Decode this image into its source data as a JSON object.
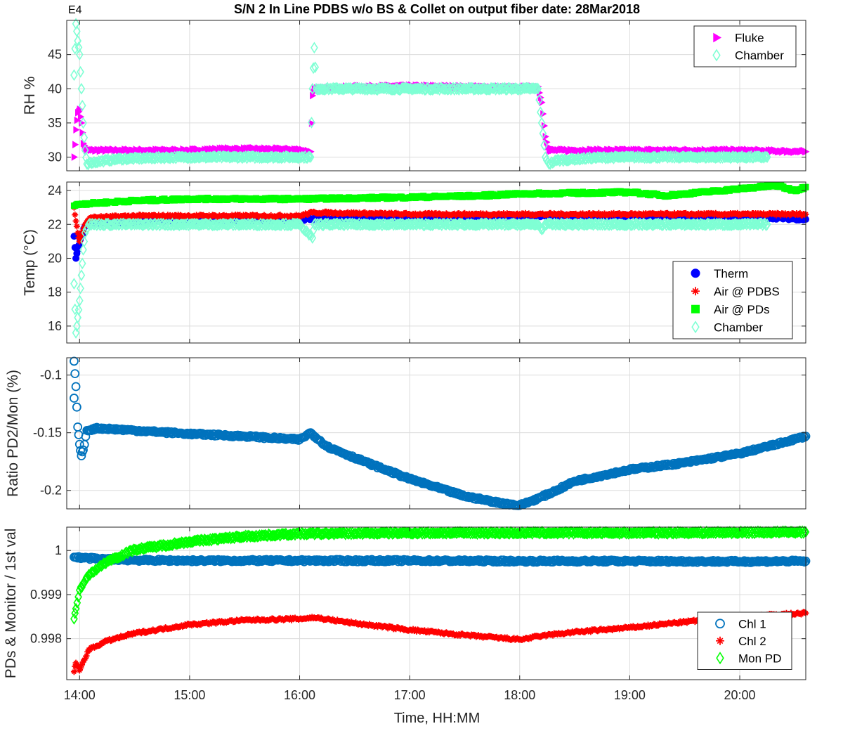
{
  "title": "S/N 2 In Line PDBS w/o BS & Collet on output fiber date: 28Mar2018",
  "exponent_label": "E4",
  "x_axis": {
    "label": "Time, HH:MM",
    "range": [
      "13:53",
      "20:36"
    ],
    "ticks": [
      "14:00",
      "15:00",
      "16:00",
      "17:00",
      "18:00",
      "19:00",
      "20:00"
    ]
  },
  "chart_data": [
    {
      "type": "scatter",
      "ylabel": "RH %",
      "ylim": [
        28,
        50
      ],
      "yticks": [
        30,
        35,
        40,
        45
      ],
      "grid": true,
      "legend_position": "top-right",
      "series": [
        {
          "name": "Fluke",
          "marker": "triangle-right",
          "color": "#ff00ff",
          "points": [
            [
              "13:57",
              30
            ],
            [
              "13:58",
              34
            ],
            [
              "13:59",
              36.5
            ],
            [
              "14:00",
              37
            ],
            [
              "14:01",
              35
            ],
            [
              "14:02",
              32
            ],
            [
              "14:04",
              31
            ],
            [
              "14:20",
              31
            ],
            [
              "14:40",
              31
            ],
            [
              "15:00",
              31
            ],
            [
              "15:20",
              31.2
            ],
            [
              "15:40",
              31.2
            ],
            [
              "16:00",
              31.1
            ],
            [
              "16:06",
              30.8
            ],
            [
              "16:07",
              39
            ],
            [
              "16:08",
              40
            ],
            [
              "16:30",
              40.3
            ],
            [
              "17:00",
              40.4
            ],
            [
              "17:30",
              40.3
            ],
            [
              "18:00",
              40.2
            ],
            [
              "18:10",
              40.3
            ],
            [
              "18:12",
              38
            ],
            [
              "18:14",
              33
            ],
            [
              "18:16",
              31
            ],
            [
              "18:30",
              31
            ],
            [
              "19:00",
              31
            ],
            [
              "19:30",
              31
            ],
            [
              "20:00",
              31
            ],
            [
              "20:36",
              30.8
            ]
          ]
        },
        {
          "name": "Chamber",
          "marker": "diamond",
          "color": "#7fffd4",
          "points": [
            [
              "13:57",
              42
            ],
            [
              "13:58",
              49.5
            ],
            [
              "13:59",
              47
            ],
            [
              "14:00",
              45
            ],
            [
              "14:01",
              40
            ],
            [
              "14:02",
              35
            ],
            [
              "14:03",
              31
            ],
            [
              "14:04",
              29
            ],
            [
              "14:06",
              29.2
            ],
            [
              "14:20",
              29.7
            ],
            [
              "14:40",
              29.9
            ],
            [
              "15:00",
              30
            ],
            [
              "15:30",
              30
            ],
            [
              "16:00",
              30
            ],
            [
              "16:06",
              30
            ],
            [
              "16:07",
              40
            ],
            [
              "16:08",
              46
            ],
            [
              "16:09",
              40
            ],
            [
              "16:30",
              40
            ],
            [
              "17:00",
              40
            ],
            [
              "17:30",
              40
            ],
            [
              "18:00",
              40
            ],
            [
              "18:10",
              40
            ],
            [
              "18:12",
              35
            ],
            [
              "18:14",
              30
            ],
            [
              "18:16",
              29
            ],
            [
              "18:20",
              29.5
            ],
            [
              "18:40",
              29.9
            ],
            [
              "19:00",
              30
            ],
            [
              "19:30",
              30
            ],
            [
              "20:00",
              30
            ],
            [
              "20:15",
              30
            ]
          ]
        }
      ]
    },
    {
      "type": "scatter",
      "ylabel": "Temp (°C)",
      "ylim": [
        15,
        24.5
      ],
      "yticks": [
        16,
        18,
        20,
        22,
        24
      ],
      "grid": true,
      "legend_position": "bottom-right",
      "series": [
        {
          "name": "Therm",
          "marker": "filled-circle",
          "color": "#0000ff",
          "points": [
            [
              "13:57",
              21.3
            ],
            [
              "13:58",
              20
            ],
            [
              "13:59",
              20.5
            ],
            [
              "14:01",
              21.3
            ],
            [
              "14:03",
              21.9
            ],
            [
              "14:10",
              22.1
            ],
            [
              "15:00",
              22.2
            ],
            [
              "16:00",
              22.3
            ],
            [
              "17:00",
              22.4
            ],
            [
              "18:00",
              22.5
            ],
            [
              "19:00",
              22.5
            ],
            [
              "20:00",
              22.5
            ],
            [
              "20:15",
              22.4
            ],
            [
              "20:36",
              22.3
            ]
          ]
        },
        {
          "name": "Air @ PDBS",
          "marker": "asterisk",
          "color": "#ff0000",
          "points": [
            [
              "13:57",
              23
            ],
            [
              "13:58",
              22.2
            ],
            [
              "13:59",
              21.5
            ],
            [
              "14:00",
              21
            ],
            [
              "14:01",
              21.4
            ],
            [
              "14:03",
              22
            ],
            [
              "14:06",
              22.4
            ],
            [
              "14:30",
              22.5
            ],
            [
              "15:00",
              22.5
            ],
            [
              "16:00",
              22.5
            ],
            [
              "16:07",
              22.7
            ],
            [
              "17:00",
              22.6
            ],
            [
              "18:00",
              22.6
            ],
            [
              "19:00",
              22.6
            ],
            [
              "20:00",
              22.6
            ],
            [
              "20:36",
              22.6
            ]
          ]
        },
        {
          "name": "Air @ PDs",
          "marker": "filled-square",
          "color": "#00ff00",
          "points": [
            [
              "13:57",
              23.1
            ],
            [
              "14:00",
              23.2
            ],
            [
              "14:30",
              23.4
            ],
            [
              "15:00",
              23.5
            ],
            [
              "16:00",
              23.5
            ],
            [
              "17:00",
              23.6
            ],
            [
              "17:40",
              23.7
            ],
            [
              "18:00",
              23.8
            ],
            [
              "18:30",
              23.85
            ],
            [
              "19:00",
              23.9
            ],
            [
              "19:20",
              23.7
            ],
            [
              "19:40",
              23.9
            ],
            [
              "20:00",
              24.1
            ],
            [
              "20:20",
              24.3
            ],
            [
              "20:30",
              24
            ],
            [
              "20:36",
              24.2
            ]
          ]
        },
        {
          "name": "Chamber",
          "marker": "diamond",
          "color": "#7fffd4",
          "points": [
            [
              "13:57",
              18.5
            ],
            [
              "13:58",
              15.6
            ],
            [
              "13:59",
              16.5
            ],
            [
              "14:00",
              17.5
            ],
            [
              "14:01",
              19
            ],
            [
              "14:02",
              20.5
            ],
            [
              "14:03",
              21.5
            ],
            [
              "14:05",
              22
            ],
            [
              "14:10",
              22
            ],
            [
              "15:00",
              22
            ],
            [
              "16:00",
              22
            ],
            [
              "16:07",
              21.2
            ],
            [
              "16:08",
              22
            ],
            [
              "17:00",
              22
            ],
            [
              "18:00",
              22
            ],
            [
              "18:10",
              22
            ],
            [
              "18:12",
              21.7
            ],
            [
              "18:14",
              22
            ],
            [
              "19:00",
              22
            ],
            [
              "20:00",
              22
            ],
            [
              "20:15",
              22
            ]
          ]
        }
      ]
    },
    {
      "type": "scatter",
      "ylabel": "Ratio PD2/Mon (%)",
      "ylim": [
        -0.216,
        -0.085
      ],
      "yticks": [
        -0.1,
        -0.15,
        -0.2
      ],
      "grid": true,
      "series": [
        {
          "name": "",
          "marker": "circle",
          "color": "#0072bd",
          "points": [
            [
              "13:57",
              -0.12
            ],
            [
              "13:57",
              -0.088
            ],
            [
              "13:58",
              -0.11
            ],
            [
              "13:59",
              -0.145
            ],
            [
              "14:00",
              -0.16
            ],
            [
              "14:01",
              -0.17
            ],
            [
              "14:02",
              -0.165
            ],
            [
              "14:04",
              -0.148
            ],
            [
              "14:10",
              -0.146
            ],
            [
              "14:30",
              -0.148
            ],
            [
              "15:00",
              -0.151
            ],
            [
              "15:30",
              -0.153
            ],
            [
              "16:00",
              -0.156
            ],
            [
              "16:06",
              -0.15
            ],
            [
              "16:15",
              -0.162
            ],
            [
              "16:40",
              -0.178
            ],
            [
              "17:00",
              -0.19
            ],
            [
              "17:30",
              -0.205
            ],
            [
              "17:50",
              -0.211
            ],
            [
              "18:00",
              -0.213
            ],
            [
              "18:10",
              -0.207
            ],
            [
              "18:20",
              -0.2
            ],
            [
              "18:30",
              -0.192
            ],
            [
              "19:00",
              -0.182
            ],
            [
              "19:30",
              -0.176
            ],
            [
              "20:00",
              -0.168
            ],
            [
              "20:20",
              -0.16
            ],
            [
              "20:36",
              -0.153
            ]
          ]
        }
      ]
    },
    {
      "type": "scatter",
      "ylabel": "PDs & Monitor / 1st val",
      "ylim": [
        0.99707,
        1.00053
      ],
      "yticks": [
        0.998,
        0.999,
        1
      ],
      "ytick_labels": [
        "0.998",
        "0.999",
        "1"
      ],
      "grid": true,
      "legend_position": "bottom-right",
      "series": [
        {
          "name": "Chl 1",
          "marker": "circle",
          "color": "#0072bd",
          "points": [
            [
              "13:57",
              0.99985
            ],
            [
              "14:10",
              0.99981
            ],
            [
              "14:30",
              0.99978
            ],
            [
              "15:00",
              0.99977
            ],
            [
              "16:00",
              0.99977
            ],
            [
              "17:00",
              0.99977
            ],
            [
              "18:00",
              0.99976
            ],
            [
              "19:00",
              0.99976
            ],
            [
              "20:00",
              0.99975
            ],
            [
              "20:36",
              0.99976
            ]
          ]
        },
        {
          "name": "Chl 2",
          "marker": "asterisk",
          "color": "#ff0000",
          "points": [
            [
              "13:57",
              0.99725
            ],
            [
              "13:58",
              0.99745
            ],
            [
              "14:00",
              0.99728
            ],
            [
              "14:05",
              0.99775
            ],
            [
              "14:15",
              0.99795
            ],
            [
              "14:30",
              0.99812
            ],
            [
              "15:00",
              0.99832
            ],
            [
              "15:30",
              0.99842
            ],
            [
              "16:00",
              0.99845
            ],
            [
              "16:08",
              0.99848
            ],
            [
              "16:30",
              0.99835
            ],
            [
              "17:00",
              0.9982
            ],
            [
              "17:30",
              0.99808
            ],
            [
              "18:00",
              0.99798
            ],
            [
              "18:15",
              0.99808
            ],
            [
              "18:30",
              0.99815
            ],
            [
              "19:00",
              0.99825
            ],
            [
              "19:30",
              0.99838
            ],
            [
              "20:00",
              0.9985
            ],
            [
              "20:36",
              0.99858
            ]
          ]
        },
        {
          "name": "Mon PD",
          "marker": "diamond",
          "color": "#00ff00",
          "points": [
            [
              "13:57",
              0.99845
            ],
            [
              "13:58",
              0.99868
            ],
            [
              "14:00",
              0.9991
            ],
            [
              "14:05",
              0.99945
            ],
            [
              "14:15",
              0.99975
            ],
            [
              "14:30",
              1.00002
            ],
            [
              "15:00",
              1.0002
            ],
            [
              "15:30",
              1.00032
            ],
            [
              "16:00",
              1.00038
            ],
            [
              "17:00",
              1.0004
            ],
            [
              "18:00",
              1.0004
            ],
            [
              "19:00",
              1.0004
            ],
            [
              "20:00",
              1.00041
            ],
            [
              "20:36",
              1.00042
            ]
          ]
        }
      ]
    }
  ]
}
